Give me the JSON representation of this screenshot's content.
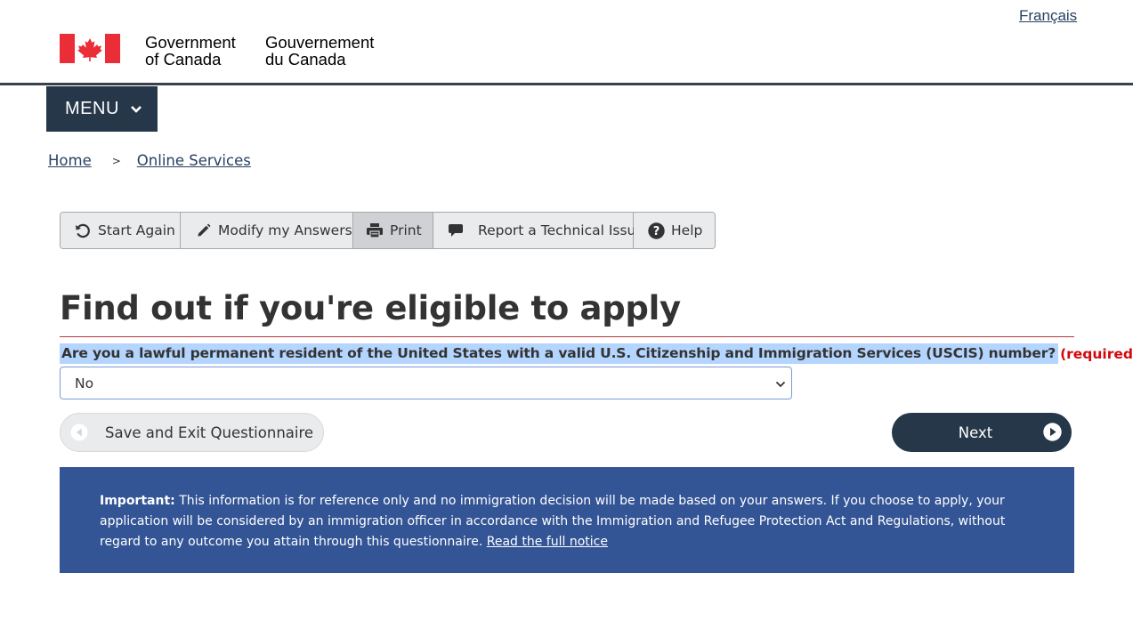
{
  "header": {
    "language_link": "Français",
    "wordmark_en_line1": "Government",
    "wordmark_en_line2": "of Canada",
    "wordmark_fr_line1": "Gouvernement",
    "wordmark_fr_line2": "du Canada",
    "menu_label": "MENU"
  },
  "breadcrumb": {
    "items": [
      "Home",
      "Online Services"
    ],
    "separator": ">"
  },
  "toolbar": {
    "start_again": "Start Again",
    "modify_answers": "Modify my Answers",
    "print": "Print",
    "report_issue": "Report a Technical Issue",
    "help": "Help"
  },
  "page": {
    "title": "Find out if you're eligible to apply"
  },
  "question": {
    "label": "Are you a lawful permanent resident of the United States with a valid U.S. Citizenship and Immigration Services (USCIS) number?",
    "required_text": "(required)",
    "selected_value": "No"
  },
  "navigation": {
    "save_exit": "Save and Exit Questionnaire",
    "next": "Next"
  },
  "notice": {
    "label": "Important:",
    "text": " This information is for reference only and no immigration decision will be made based on your answers. If you choose to apply, your application will be considered by an immigration officer in accordance with the Immigration and Refugee Protection Act and Regulations, without regard to any outcome you attain through this questionnaire. ",
    "link": "Read the full notice"
  },
  "colors": {
    "navy": "#26374a",
    "link": "#284162",
    "flag_red": "#eb2d37",
    "selection_highlight": "#b4d5fe",
    "required_red": "#d3080c",
    "notice_blue": "#335495",
    "title_rule": "#af3c43"
  },
  "icons": {
    "menu": "chevron-down-icon",
    "start_again": "refresh-icon",
    "modify": "pencil-icon",
    "print": "printer-icon",
    "report": "speech-bubble-icon",
    "help": "question-circle-icon",
    "save": "circle-arrow-left-icon",
    "next": "circle-arrow-right-icon"
  }
}
